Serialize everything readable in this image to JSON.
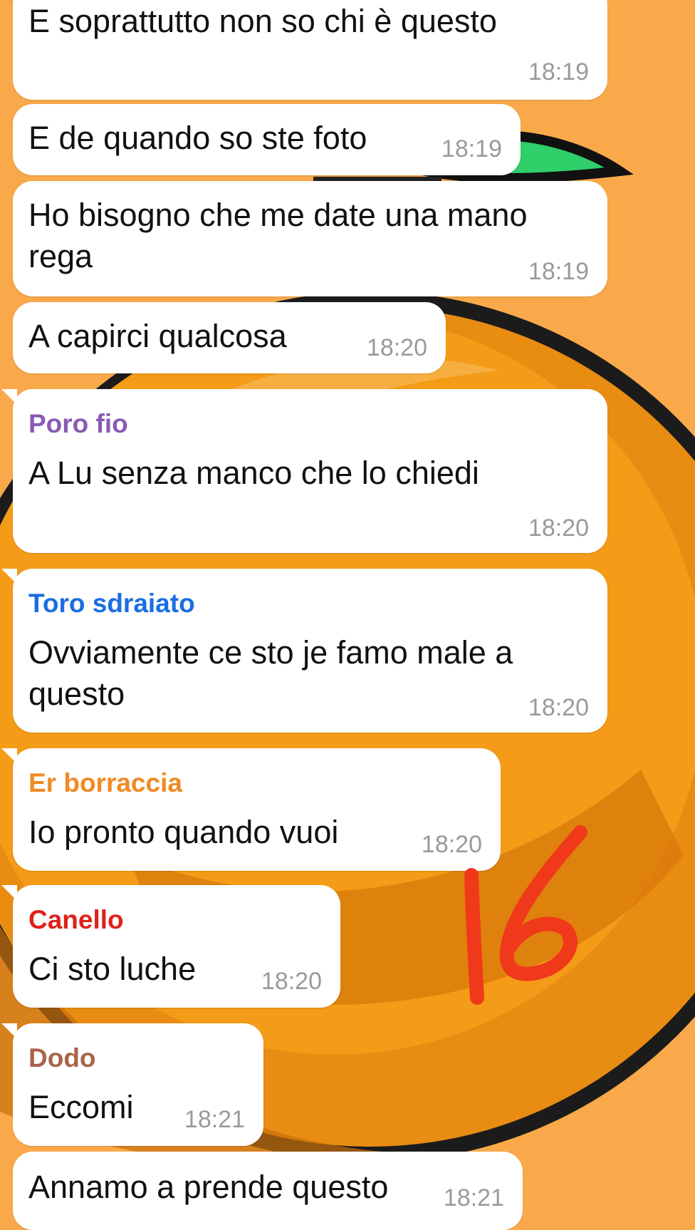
{
  "colors": {
    "background": "#f9a94a",
    "bubble": "#ffffff",
    "timestamp": "#9a9a9a",
    "annotation": "#f0391b"
  },
  "wallpaper": {
    "icon": "orange-fruit-illustration"
  },
  "annotation": {
    "text": "16"
  },
  "messages": [
    {
      "sender": "",
      "sender_color": "",
      "text": [
        "E soprattutto non so chi è questo"
      ],
      "time": "18:19"
    },
    {
      "sender": "",
      "sender_color": "",
      "text": [
        "E de quando so ste foto"
      ],
      "time": "18:19"
    },
    {
      "sender": "",
      "sender_color": "",
      "text": [
        "Ho bisogno che me date una mano",
        "rega"
      ],
      "time": "18:19"
    },
    {
      "sender": "",
      "sender_color": "",
      "text": [
        "A capirci qualcosa"
      ],
      "time": "18:20"
    },
    {
      "sender": "Poro fio",
      "sender_color": "#8a59b5",
      "text": [
        "A Lu senza manco che lo chiedi"
      ],
      "time": "18:20"
    },
    {
      "sender": "Toro sdraiato",
      "sender_color": "#1a6ee0",
      "text": [
        "Ovviamente ce sto je famo male a",
        "questo"
      ],
      "time": "18:20"
    },
    {
      "sender": "Er borraccia",
      "sender_color": "#f08a24",
      "text": [
        "Io pronto quando vuoi"
      ],
      "time": "18:20"
    },
    {
      "sender": "Canello",
      "sender_color": "#e0211b",
      "text": [
        "Ci sto luche"
      ],
      "time": "18:20"
    },
    {
      "sender": "Dodo",
      "sender_color": "#a8644a",
      "text": [
        "Eccomi"
      ],
      "time": "18:21"
    },
    {
      "sender": "",
      "sender_color": "",
      "text": [
        "Annamo a prende questo"
      ],
      "time": "18:21"
    }
  ]
}
